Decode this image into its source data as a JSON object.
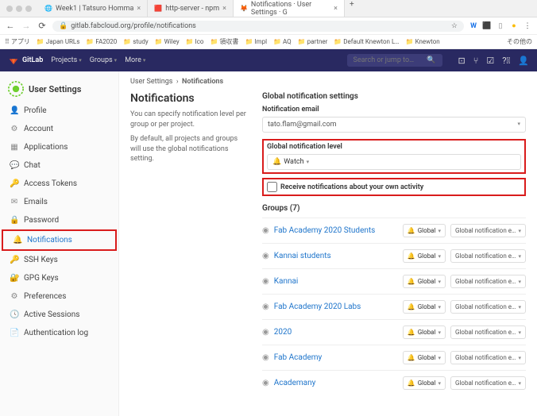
{
  "browser": {
    "tabs": [
      {
        "favicon": "🌐",
        "title": "Week1 | Tatsuro Homma"
      },
      {
        "favicon": "🟥",
        "title": "http-server - npm"
      },
      {
        "favicon": "🦊",
        "title": "Notifications · User Settings · G"
      }
    ],
    "url": "gitlab.fabcloud.org/profile/notifications",
    "bookmarks": [
      "アプリ",
      "📁 Japan URLs",
      "📁 FA2020",
      "📁 study",
      "📁 Wiley",
      "📁 Ico",
      "📁 領収書",
      "📁 Impl",
      "📁 AQ",
      "📁 partner",
      "📁 Default Knewton L…",
      "📁 Knewton",
      "その他の"
    ]
  },
  "gitlab_header": {
    "brand": "GitLab",
    "nav": [
      "Projects",
      "Groups",
      "More"
    ],
    "search_placeholder": "Search or jump to…"
  },
  "sidebar": {
    "title": "User Settings",
    "items": [
      {
        "icon": "👤",
        "label": "Profile"
      },
      {
        "icon": "⚙",
        "label": "Account"
      },
      {
        "icon": "▦",
        "label": "Applications"
      },
      {
        "icon": "💬",
        "label": "Chat"
      },
      {
        "icon": "🔑",
        "label": "Access Tokens"
      },
      {
        "icon": "✉",
        "label": "Emails"
      },
      {
        "icon": "🔒",
        "label": "Password"
      },
      {
        "icon": "🔔",
        "label": "Notifications"
      },
      {
        "icon": "🔑",
        "label": "SSH Keys"
      },
      {
        "icon": "🔐",
        "label": "GPG Keys"
      },
      {
        "icon": "⚙",
        "label": "Preferences"
      },
      {
        "icon": "🕓",
        "label": "Active Sessions"
      },
      {
        "icon": "📄",
        "label": "Authentication log"
      }
    ],
    "active": 7
  },
  "breadcrumb": {
    "a": "User Settings",
    "b": "Notifications"
  },
  "page": {
    "title": "Notifications",
    "desc1": "You can specify notification level per group or per project.",
    "desc2": "By default, all projects and groups will use the global notifications setting."
  },
  "settings": {
    "heading": "Global notification settings",
    "email_label": "Notification email",
    "email_value": "tato.flam@gmail.com",
    "level_label": "Global notification level",
    "level_value": "Watch",
    "checkbox_label": "Receive notifications about your own activity"
  },
  "groups": {
    "heading": "Groups (7)",
    "global_label": "Global",
    "email_label": "Global notification e…",
    "items": [
      "Fab Academy 2020 Students",
      "Kannai students",
      "Kannai",
      "Fab Academy 2020 Labs",
      "2020",
      "Fab Academy",
      "Academany"
    ]
  }
}
